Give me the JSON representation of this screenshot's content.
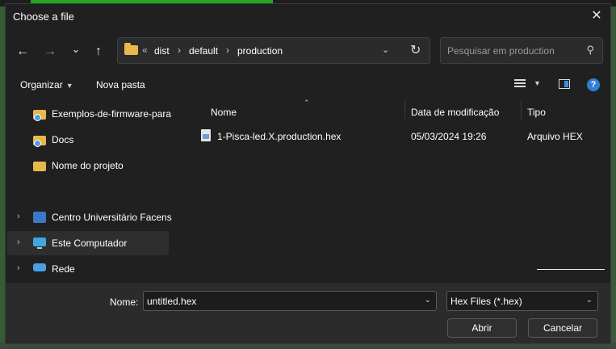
{
  "window": {
    "title": "Choose a file",
    "close_glyph": "✕"
  },
  "nav": {
    "back_glyph": "←",
    "forward_glyph": "→",
    "recent_glyph": "⌄",
    "up_glyph": "↑"
  },
  "address": {
    "overflow_glyph": "«",
    "crumbs": [
      "dist",
      "default",
      "production"
    ],
    "chevron_glyph": "›",
    "dropdown_glyph": "⌄",
    "refresh_glyph": "↻"
  },
  "search": {
    "placeholder": "Pesquisar em production",
    "glyph": "⚲"
  },
  "toolbar": {
    "organize": "Organizar",
    "new_folder": "Nova pasta",
    "caret": "▼",
    "help": "?"
  },
  "sidebar": {
    "items": [
      {
        "label": "Exemplos-de-firmware-para",
        "icon": "folder-network-icon"
      },
      {
        "label": "Docs",
        "icon": "folder-network-icon"
      },
      {
        "label": "Nome do projeto",
        "icon": "folder-icon"
      },
      {
        "label": "Centro Universitário Facens",
        "icon": "building-icon"
      },
      {
        "label": "Este Computador",
        "icon": "computer-icon"
      },
      {
        "label": "Rede",
        "icon": "network-icon"
      }
    ],
    "chevron_glyph": "›"
  },
  "columns": {
    "name": "Nome",
    "modified": "Data de modificação",
    "type": "Tipo",
    "sort_glyph": "⌃"
  },
  "files": [
    {
      "name": "1-Pisca-led.X.production.hex",
      "modified": "05/03/2024 19:26",
      "type": "Arquivo HEX"
    }
  ],
  "bottom": {
    "name_label": "Nome:",
    "filename_value": "untitled.hex",
    "filter_value": "Hex Files (*.hex)",
    "dropdown_glyph": "⌄",
    "open_button": "Abrir",
    "cancel_button": "Cancelar"
  },
  "colors": {
    "dialog_bg": "#202020",
    "bottom_bg": "#2b2b2b",
    "accent": "#2f7fd6",
    "folder": "#e8b84a"
  }
}
